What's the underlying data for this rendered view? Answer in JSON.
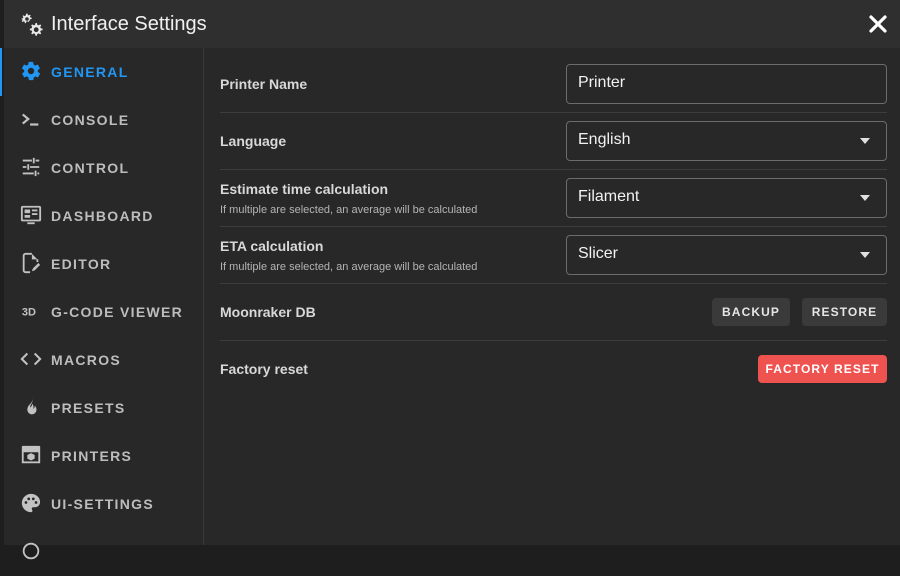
{
  "window": {
    "title": "Interface Settings"
  },
  "sidebar": {
    "items": [
      {
        "label": "GENERAL",
        "icon": "gear-icon",
        "active": true
      },
      {
        "label": "CONSOLE",
        "icon": "console-icon"
      },
      {
        "label": "CONTROL",
        "icon": "tune-icon"
      },
      {
        "label": "DASHBOARD",
        "icon": "dashboard-icon"
      },
      {
        "label": "EDITOR",
        "icon": "editor-icon"
      },
      {
        "label": "G-CODE VIEWER",
        "icon": "3d-icon"
      },
      {
        "label": "MACROS",
        "icon": "code-brackets-icon"
      },
      {
        "label": "PRESETS",
        "icon": "fire-icon"
      },
      {
        "label": "PRINTERS",
        "icon": "printer-icon"
      },
      {
        "label": "UI-SETTINGS",
        "icon": "palette-icon"
      }
    ],
    "accent_color": "#2196f3"
  },
  "settings": {
    "printer_name": {
      "label": "Printer Name",
      "value": "Printer"
    },
    "language": {
      "label": "Language",
      "value": "English"
    },
    "estimate_time": {
      "label": "Estimate time calculation",
      "hint": "If multiple are selected, an average will be calculated",
      "value": "Filament"
    },
    "eta": {
      "label": "ETA calculation",
      "hint": "If multiple are selected, an average will be calculated",
      "value": "Slicer"
    },
    "moonraker_db": {
      "label": "Moonraker DB",
      "backup_label": "BACKUP",
      "restore_label": "RESTORE"
    },
    "factory_reset": {
      "label": "Factory reset",
      "button_label": "FACTORY RESET",
      "button_color": "#ef5350"
    }
  }
}
